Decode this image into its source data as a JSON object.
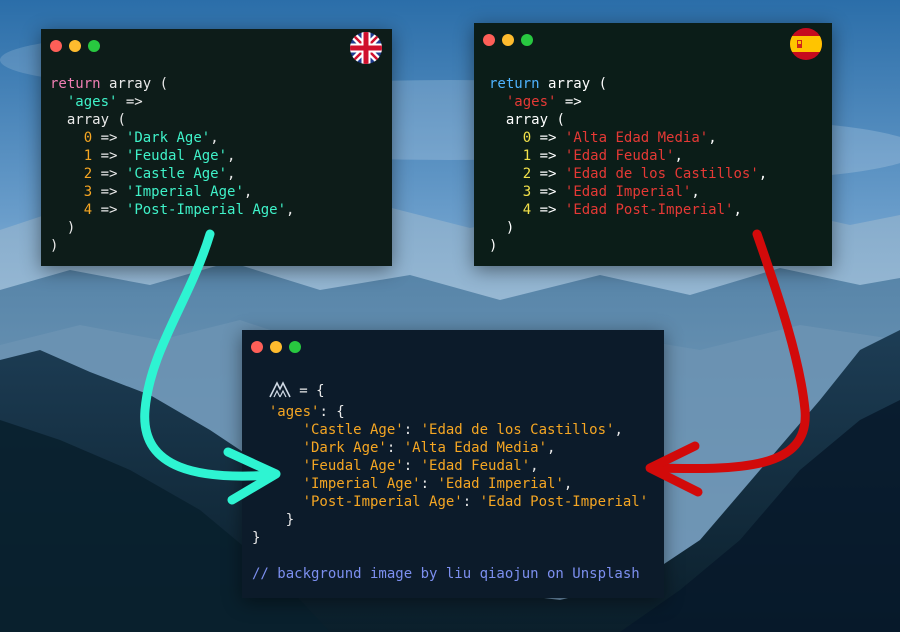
{
  "colors": {
    "arrow_english": "#2ef4d2",
    "arrow_spanish": "#d20a0a",
    "sky_top": "#2b6ea9",
    "mountain_dark": "#0b1f2b"
  },
  "window_english": {
    "flag_icon": "uk-flag-icon",
    "lines": {
      "l1_kw": "return",
      "l1_fn": "array",
      "l1_rest": " (",
      "l2_key": "'ages'",
      "l2_rest": " =>",
      "l3_fn": "array",
      "l3_rest": " (",
      "items": [
        {
          "index": "0",
          "value": "'Dark Age'"
        },
        {
          "index": "1",
          "value": "'Feudal Age'"
        },
        {
          "index": "2",
          "value": "'Castle Age'"
        },
        {
          "index": "3",
          "value": "'Imperial Age'"
        },
        {
          "index": "4",
          "value": "'Post-Imperial Age'"
        }
      ],
      "close_inner": ")",
      "close_outer": ")"
    }
  },
  "window_spanish": {
    "flag_icon": "spain-flag-icon",
    "lines": {
      "l1_kw": "return",
      "l1_fn": "array",
      "l1_rest": " (",
      "l2_key": "'ages'",
      "l2_rest": " =>",
      "l3_fn": "array",
      "l3_rest": " (",
      "items": [
        {
          "index": "0",
          "value": "'Alta Edad Media'"
        },
        {
          "index": "1",
          "value": "'Edad Feudal'"
        },
        {
          "index": "2",
          "value": "'Edad de los Castillos'"
        },
        {
          "index": "3",
          "value": "'Edad Imperial'"
        },
        {
          "index": "4",
          "value": "'Edad Post-Imperial'"
        }
      ],
      "close_inner": ")",
      "close_outer": ")"
    }
  },
  "window_output": {
    "ident_icon": "mountain-logo-icon",
    "assign": " = {",
    "ages_key": "'ages'",
    "ages_rest": ": {",
    "pairs": [
      {
        "en": "'Castle Age'",
        "es": "'Edad de los Castillos'",
        "sep": ": ",
        "end": ","
      },
      {
        "en": "'Dark Age'",
        "es": "'Alta Edad Media'",
        "sep": ": ",
        "end": ","
      },
      {
        "en": "'Feudal Age'",
        "es": "'Edad Feudal'",
        "sep": ": ",
        "end": ","
      },
      {
        "en": "'Imperial Age'",
        "es": "'Edad Imperial'",
        "sep": ": ",
        "end": ","
      },
      {
        "en": "'Post-Imperial Age'",
        "es": "'Edad Post-Imperial'",
        "sep": ": ",
        "end": ""
      }
    ],
    "close_inner": "}",
    "close_outer": "}",
    "comment": "// background image by liu qiaojun on Unsplash"
  }
}
